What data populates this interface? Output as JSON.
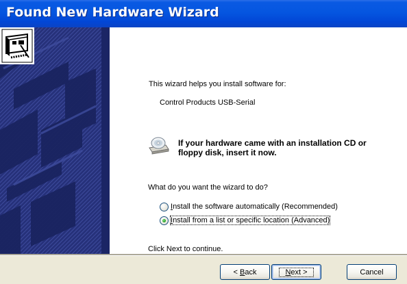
{
  "window": {
    "title": "Found New Hardware Wizard"
  },
  "content": {
    "intro": "This wizard helps you install software for:",
    "device_name": "Control Products USB-Serial",
    "cd_prompt": "If your hardware came with an installation CD or floppy disk, insert it now.",
    "question": "What do you want the wizard to do?",
    "options": [
      {
        "label": "Install the software automatically (Recommended)",
        "accel": "I",
        "selected": false
      },
      {
        "label": "Install from a list or specific location (Advanced)",
        "accel": "I",
        "selected": true
      }
    ],
    "footer_text": "Click Next to continue."
  },
  "buttons": {
    "back": {
      "prefix": "< ",
      "accel": "B",
      "rest": "ack"
    },
    "next": {
      "accel": "N",
      "rest": "ext >"
    },
    "cancel": {
      "label": "Cancel"
    }
  },
  "icons": {
    "wizard": "hardware-card-icon",
    "cd": "cd-drive-icon"
  },
  "colors": {
    "title_bar": "#0556e0",
    "sidebar": "#1f2a6e",
    "dialog_bg": "#ECE9D8",
    "radio_selected": "#21a121"
  }
}
